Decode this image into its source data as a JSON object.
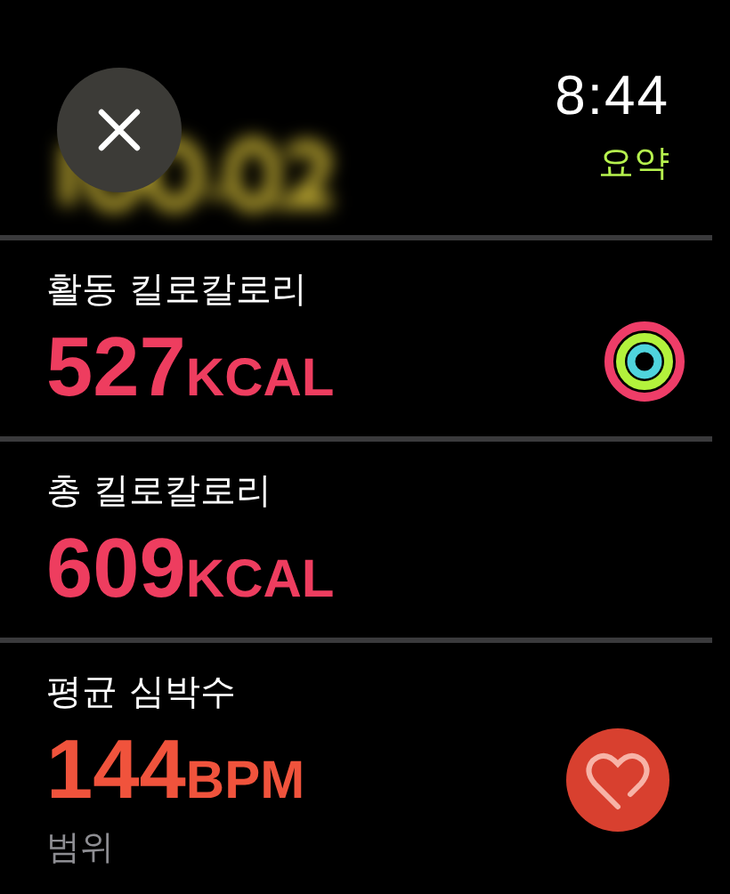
{
  "header": {
    "time": "8:44",
    "title": "요약"
  },
  "metrics": [
    {
      "kind": "rings",
      "label": "활동 킬로칼로리",
      "value": "527",
      "unit": "KCAL",
      "color": "#ee3d5f"
    },
    {
      "kind": "plain",
      "label": "총 킬로칼로리",
      "value": "609",
      "unit": "KCAL",
      "color": "#ee3d5f"
    },
    {
      "kind": "heart",
      "label": "평균 심박수",
      "value": "144",
      "unit": "BPM",
      "color": "#f0533c",
      "sublabel": "범위"
    }
  ]
}
